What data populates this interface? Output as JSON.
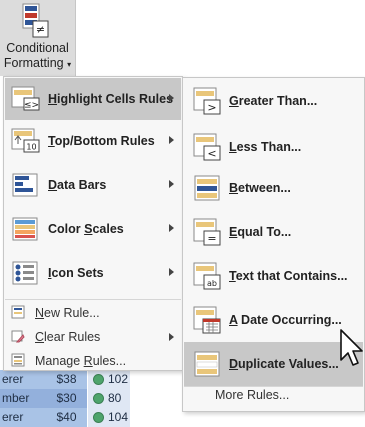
{
  "ribbon": {
    "button_label_line1": "Conditional",
    "button_label_line2": "Formatting",
    "dropdown_caret": "▾"
  },
  "menu": {
    "items": [
      {
        "label": "Highlight Cells Rules",
        "mnemonic": "H",
        "icon": "highlight-cells-icon",
        "has_submenu": true,
        "active": true
      },
      {
        "label": "Top/Bottom Rules",
        "mnemonic": "T",
        "icon": "top-bottom-icon",
        "has_submenu": true
      },
      {
        "label": "Data Bars",
        "mnemonic": "D",
        "icon": "data-bars-icon",
        "has_submenu": true
      },
      {
        "label": "Color Scales",
        "mnemonic": "S",
        "icon": "color-scales-icon",
        "has_submenu": true
      },
      {
        "label": "Icon Sets",
        "mnemonic": "I",
        "icon": "icon-sets-icon",
        "has_submenu": true
      }
    ],
    "small_items": [
      {
        "label": "New Rule...",
        "mnemonic": "N",
        "icon": "new-rule-icon"
      },
      {
        "label": "Clear Rules",
        "mnemonic": "C",
        "icon": "clear-rules-icon",
        "has_submenu": true
      },
      {
        "label": "Manage Rules...",
        "mnemonic": "R",
        "icon": "manage-rules-icon"
      }
    ]
  },
  "submenu": {
    "items": [
      {
        "label": "Greater Than...",
        "mnemonic": "G",
        "icon": "greater-than-icon",
        "symbol": ">"
      },
      {
        "label": "Less Than...",
        "mnemonic": "L",
        "icon": "less-than-icon",
        "symbol": "<"
      },
      {
        "label": "Between...",
        "mnemonic": "B",
        "icon": "between-icon"
      },
      {
        "label": "Equal To...",
        "mnemonic": "E",
        "icon": "equal-to-icon",
        "symbol": "="
      },
      {
        "label": "Text that Contains...",
        "mnemonic": "T",
        "icon": "text-contains-icon",
        "symbol": "ab"
      },
      {
        "label": "A Date Occurring...",
        "mnemonic": "A",
        "icon": "date-occurring-icon"
      },
      {
        "label": "Duplicate Values...",
        "mnemonic": "D",
        "icon": "duplicate-values-icon",
        "active": true
      }
    ],
    "more_rules": "More Rules..."
  },
  "sheet": {
    "rows": [
      {
        "name": "erer",
        "price": "$38",
        "score": "102"
      },
      {
        "name": "mber",
        "price": "$30",
        "score": "80"
      },
      {
        "name": "erer",
        "price": "$40",
        "score": "104"
      }
    ]
  },
  "colors": {
    "menu_bg": "#f7f7f7",
    "hover_bg": "#c8c8c8",
    "accent_blue": "#2f5597",
    "cell_highlight": "#e9c67a"
  }
}
